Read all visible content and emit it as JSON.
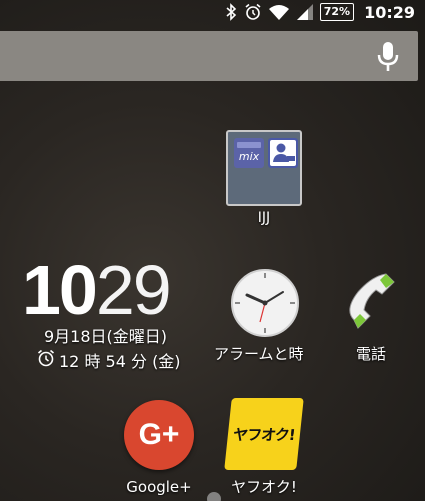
{
  "status_bar": {
    "battery": "72%",
    "time": "10:29"
  },
  "search": {
    "icon": "mic-icon"
  },
  "folder": {
    "label": "IJJ",
    "mini_app_text": "mix"
  },
  "clock_widget": {
    "hours": "10",
    "minutes": "29",
    "date": "9月18日(金曜日)",
    "alarm": "12 時 54 分 (金)"
  },
  "apps": {
    "clock": "アラームと時",
    "phone": "電話",
    "gplus_icon_text": "G+",
    "gplus": "Google+",
    "yahoo_icon_text": "ヤフオク!",
    "yahoo": "ヤフオク!"
  },
  "colors": {
    "gplus": "#d9472f",
    "yahoo": "#f7d21b",
    "phone_green": "#7dc73a"
  }
}
